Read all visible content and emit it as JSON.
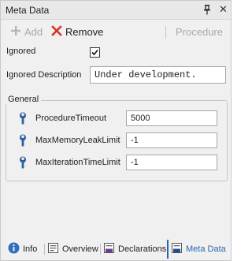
{
  "panel": {
    "title": "Meta Data",
    "pin_icon": "pin-icon",
    "close_icon": "close-icon"
  },
  "toolbar": {
    "add_label": "Add",
    "remove_label": "Remove",
    "procedure_label": "Procedure"
  },
  "form": {
    "ignored_label": "Ignored",
    "ignored_checked": true,
    "ignored_description_label": "Ignored Description",
    "ignored_description_value": "Under development."
  },
  "general": {
    "title": "General",
    "properties": [
      {
        "label": "ProcedureTimeout",
        "value": "5000"
      },
      {
        "label": "MaxMemoryLeakLimit",
        "value": "-1"
      },
      {
        "label": "MaxIterationTimeLimit",
        "value": "-1"
      }
    ]
  },
  "tabs": [
    {
      "label": "Info",
      "icon": "info-icon",
      "active": false
    },
    {
      "label": "Overview",
      "icon": "overview-icon",
      "active": false
    },
    {
      "label": "Declarations",
      "icon": "declarations-icon",
      "active": false
    },
    {
      "label": "Meta Data",
      "icon": "meta-data-icon",
      "active": true
    }
  ],
  "colors": {
    "accent": "#2a66b0",
    "remove_red": "#d9352b",
    "disabled": "#a9a9a9"
  }
}
